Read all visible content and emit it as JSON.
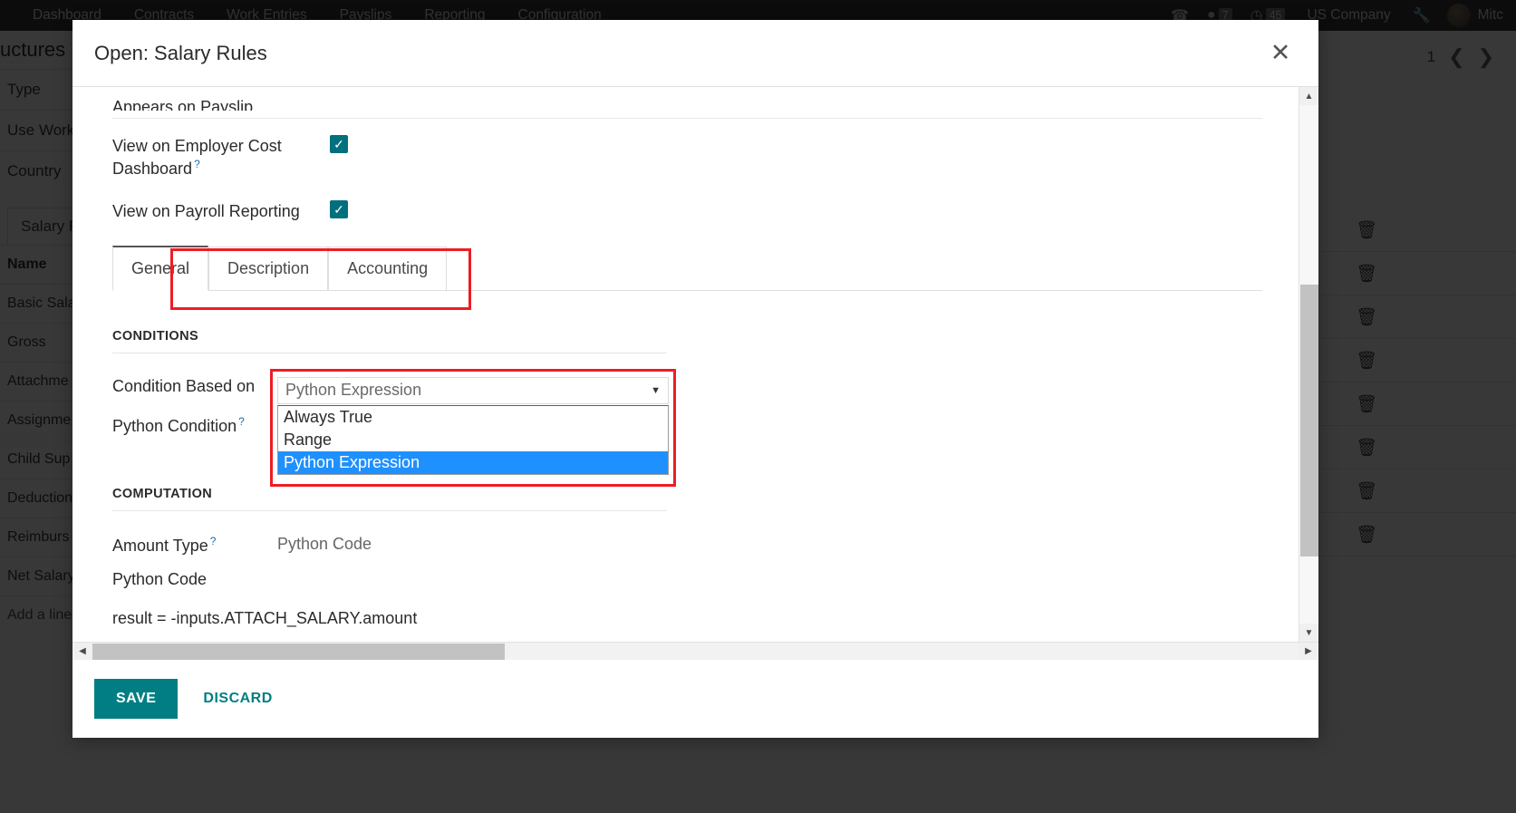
{
  "topbar": {
    "menu": [
      "Dashboard",
      "Contracts",
      "Work Entries",
      "Payslips",
      "Reporting",
      "Configuration"
    ],
    "phone_icon": "phone-icon",
    "chat_icon": "chat-bubble-icon",
    "chat_count": "7",
    "clock_icon": "clock-icon",
    "clock_count": "45",
    "company": "US Company",
    "wrench_icon": "wrench-icon",
    "user": "Mitc"
  },
  "background": {
    "breadcrumb": "uctures",
    "fields": [
      "Type",
      "Use Work",
      "Country"
    ],
    "tab": "Salary R",
    "table_header": "Name",
    "rows": [
      "Basic Sala",
      "Gross",
      "Attachme",
      "Assignme",
      "Child Sup",
      "Deduction",
      "Reimburs",
      "Net Salary"
    ],
    "add_line": "Add a line",
    "pager_count": "1",
    "prev_icon": "chevron-left-icon",
    "next_icon": "chevron-right-icon",
    "delete_icon": "trash-icon"
  },
  "modal": {
    "title": "Open: Salary Rules",
    "close_icon": "close-icon",
    "cut_field_label": "Appears on Payslip",
    "checkboxes": [
      {
        "label": "View on Employer Cost Dashboard",
        "has_tip": true,
        "checked": true
      },
      {
        "label": "View on Payroll Reporting",
        "has_tip": false,
        "checked": true
      }
    ],
    "tabs": [
      {
        "label": "General",
        "active": true
      },
      {
        "label": "Description",
        "active": false
      },
      {
        "label": "Accounting",
        "active": false
      }
    ],
    "conditions": {
      "section": "CONDITIONS",
      "condition_label": "Condition Based on",
      "condition_value": "Python Expression",
      "condition_options": [
        "Always True",
        "Range",
        "Python Expression"
      ],
      "condition_selected": "Python Expression",
      "python_condition_label": "Python Condition",
      "python_condition_tip": "?"
    },
    "computation": {
      "section": "COMPUTATION",
      "amount_type_label": "Amount Type",
      "amount_type_tip": "?",
      "amount_type_value": "Python Code",
      "python_code_label": "Python Code",
      "python_code_value": "result = -inputs.ATTACH_SALARY.amount"
    },
    "footer": {
      "save_label": "SAVE",
      "discard_label": "DISCARD"
    },
    "scroll": {
      "up_icon": "triangle-up-icon",
      "down_icon": "triangle-down-icon",
      "left_icon": "triangle-left-icon",
      "right_icon": "triangle-right-icon"
    }
  },
  "colors": {
    "accent_teal": "#017e84",
    "checkbox_teal": "#00707f",
    "highlight_red": "#ee1c25",
    "option_highlight_blue": "#1e90ff"
  }
}
